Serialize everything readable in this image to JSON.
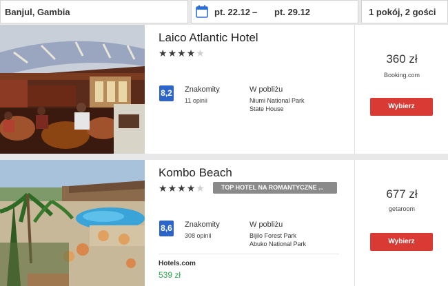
{
  "search": {
    "location": "Banjul, Gambia",
    "date_from": "pt. 22.12",
    "date_sep": "–",
    "date_to": "pt. 29.12",
    "rooms": "1 pokój, 2 gości"
  },
  "hotels": [
    {
      "name": "Laico Atlantic Hotel",
      "stars": 4,
      "score": "8,2",
      "rating_label": "Znakomity",
      "reviews": "11 opinii",
      "nearby_label": "W pobliżu",
      "nearby": [
        "Niumi National Park",
        "State House"
      ],
      "price": "360 zł",
      "provider": "Booking.com",
      "button": "Wybierz"
    },
    {
      "name": "Kombo Beach",
      "stars": 4,
      "badge": "TOP HOTEL NA ROMANTYCZNE ...",
      "score": "8,6",
      "rating_label": "Znakomity",
      "reviews": "308 opinii",
      "nearby_label": "W pobliżu",
      "nearby": [
        "Bijilo Forest Park",
        "Abuko National Park"
      ],
      "price": "677 zł",
      "provider": "getaroom",
      "button": "Wybierz",
      "alt_provider": "Hotels.com",
      "alt_price": "539 zł"
    }
  ],
  "colors": {
    "accent_button": "#d93b34",
    "score_badge": "#2d64c8",
    "alt_price": "#2fa84f",
    "calendar_icon": "#2b6fd4"
  },
  "icons": {
    "calendar": "calendar-icon",
    "star": "star-icon"
  }
}
